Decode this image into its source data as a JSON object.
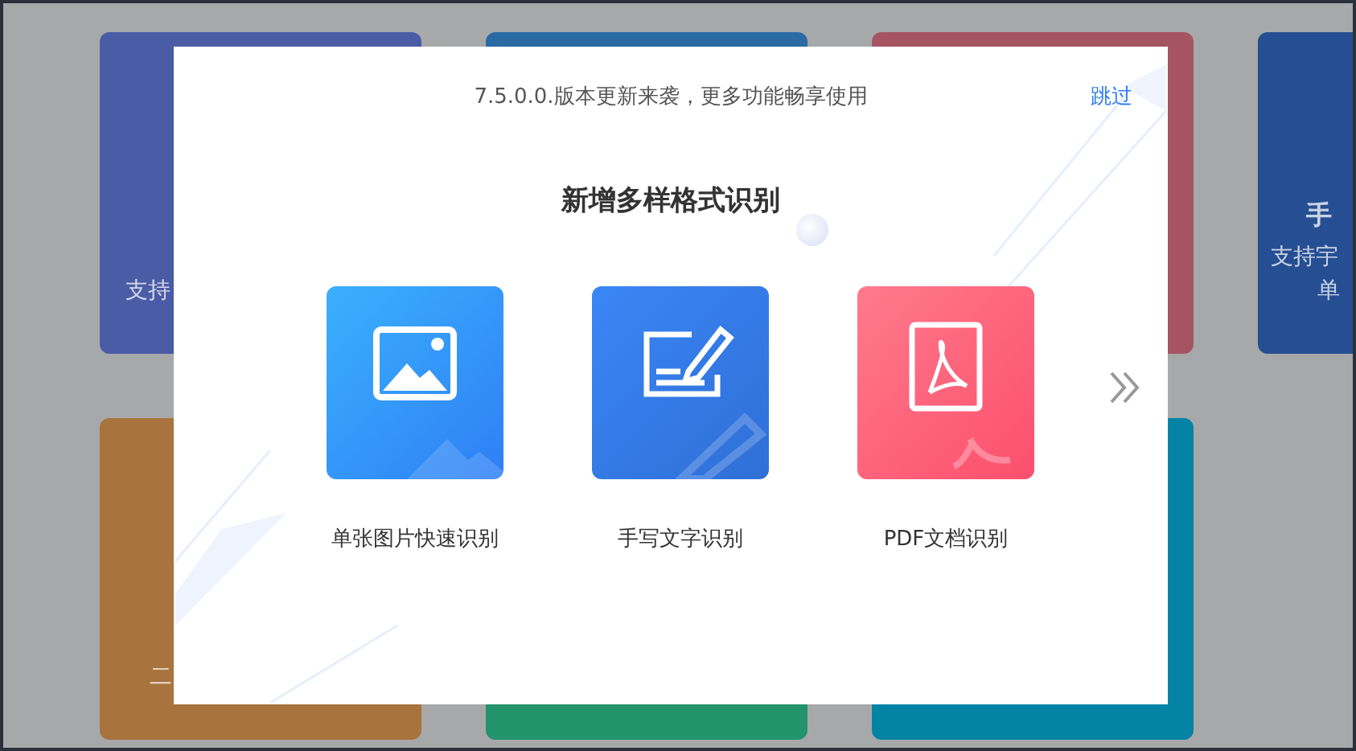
{
  "background_cards": [
    {
      "color": "#4a5ca6",
      "lines": [
        {
          "text": "支持",
          "kind": "desc"
        }
      ]
    },
    {
      "color": "#2a6aa5"
    },
    {
      "color": "#a75462"
    },
    {
      "color": "#264f93",
      "lines": [
        {
          "text": "手",
          "kind": "title"
        },
        {
          "text": "支持宇",
          "kind": "desc"
        },
        {
          "text": "单",
          "kind": "desc2"
        }
      ]
    },
    {
      "color": "#a8733d",
      "lines": [
        {
          "text": "二",
          "kind": "desc"
        }
      ]
    },
    {
      "color": "#22936b"
    },
    {
      "color": "#0483a4"
    }
  ],
  "dialog": {
    "notice": "7.5.0.0.版本更新来袭，更多功能畅享使用",
    "skip_link": "跳过",
    "title": "新增多样格式识别",
    "features": [
      {
        "kind": "image",
        "label": "单张图片快速识别"
      },
      {
        "kind": "handwriting",
        "label": "手写文字识别"
      },
      {
        "kind": "pdf",
        "label": "PDF文档识别"
      }
    ]
  }
}
